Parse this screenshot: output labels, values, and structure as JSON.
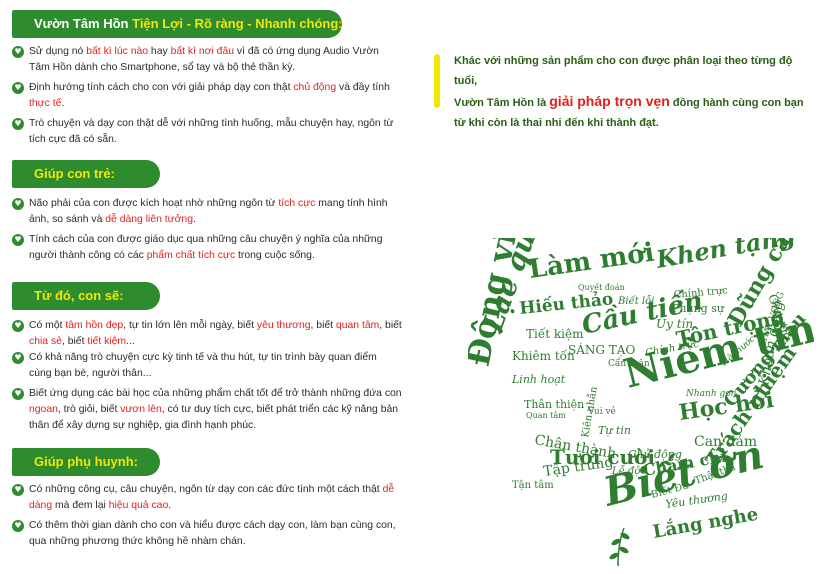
{
  "sections": [
    {
      "banner": {
        "prefix": "Vườn Tâm Hồn ",
        "highlight": "Tiện Lợi - Rõ ràng - Nhanh chóng:"
      },
      "bullets": [
        {
          "parts": [
            {
              "t": "Sử dụng nó "
            },
            {
              "t": "bất kì lúc nào",
              "red": true
            },
            {
              "t": " hay "
            },
            {
              "t": "bất kì nơi đâu",
              "red": true
            },
            {
              "t": " vì đã có ứng dụng Audio Vườn Tâm Hồn dành cho Smartphone, sổ tay và bộ thẻ thần kỳ."
            }
          ]
        },
        {
          "parts": [
            {
              "t": "Định hướng tính cách cho con với giải pháp dạy con thật "
            },
            {
              "t": "chủ động",
              "red": true
            },
            {
              "t": " và đầy tính "
            },
            {
              "t": "thực tế",
              "red": true
            },
            {
              "t": "."
            }
          ]
        },
        {
          "parts": [
            {
              "t": "Trò chuyện và dạy con thật dễ với những tình huống, mẫu chuyện hay, ngôn từ tích cực đã có sẵn."
            }
          ]
        }
      ]
    },
    {
      "banner": {
        "prefix": "",
        "highlight": "Giúp con trẻ:"
      },
      "bullets": [
        {
          "parts": [
            {
              "t": "Não phải của con được kích hoạt nhờ những ngôn từ "
            },
            {
              "t": "tích cực",
              "red": true
            },
            {
              "t": " mang tính hình ảnh, so sánh và "
            },
            {
              "t": "dễ dàng liên tưởng",
              "red": true
            },
            {
              "t": "."
            }
          ]
        },
        {
          "parts": [
            {
              "t": "Tính cách của con được giáo dục qua những câu chuyện ý nghĩa của những người thành công có các "
            },
            {
              "t": "phẩm chất tích cực",
              "red": true
            },
            {
              "t": " trong cuộc sống."
            }
          ]
        }
      ]
    },
    {
      "banner": {
        "prefix": "",
        "highlight": "Từ đó, con sẽ:"
      },
      "bullets": [
        {
          "parts": [
            {
              "t": "Có một "
            },
            {
              "t": "tâm hồn đẹp",
              "red": true
            },
            {
              "t": ", tự tin lớn lên mỗi ngày, biết "
            },
            {
              "t": "yêu thương",
              "red": true
            },
            {
              "t": ", biết "
            },
            {
              "t": "quan tâm",
              "red": true
            },
            {
              "t": ", biết "
            },
            {
              "t": "chia sẻ",
              "red": true
            },
            {
              "t": ", biết "
            },
            {
              "t": "tiết kiệm",
              "red": true
            },
            {
              "t": "..."
            }
          ]
        },
        {
          "parts": [
            {
              "t": "Có khả năng trò chuyện cực kỳ tinh tế và thu hút, tự tin trình bày quan điểm cùng bạn bè, người thân..."
            }
          ]
        },
        {
          "parts": [
            {
              "t": "Biết ứng dụng các bài học của những phẩm chất tốt để trở thành những đứa con "
            },
            {
              "t": "ngoan",
              "red": true
            },
            {
              "t": ", trò giỏi, biết "
            },
            {
              "t": "vươn lên",
              "red": true
            },
            {
              "t": ", có tư duy tích cực, biết phát triển các kỹ năng bản thân để xây dựng sự nghiệp, gia đình hạnh phúc."
            }
          ]
        }
      ]
    },
    {
      "banner": {
        "prefix": "",
        "highlight": "Giúp phụ huynh:"
      },
      "bullets": [
        {
          "parts": [
            {
              "t": "Có những công cụ, câu chuyện, ngôn từ dạy con các đức tính một cách thật "
            },
            {
              "t": "dễ dàng",
              "red": true
            },
            {
              "t": " mà đem lại "
            },
            {
              "t": "hiệu quả cao",
              "red": true
            },
            {
              "t": "."
            }
          ]
        },
        {
          "parts": [
            {
              "t": "Có thêm thời gian dành cho con và hiểu được cách dạy con, làm bạn cùng con, qua những phương thức không hề nhàm chán."
            }
          ]
        }
      ]
    }
  ],
  "intro": {
    "line1": "Khác với những sản phẩm cho con được phân loại theo từng độ tuổi,",
    "line2_prefix": "Vườn Tâm Hồn là ",
    "line2_highlight": "giải pháp trọn vẹn",
    "line2_suffix": " đồng hành cùng con bạn",
    "line3": "từ khi còn là thai nhi đến khi thành đạt."
  },
  "heart_words": [
    "Làm mới",
    "Khen tặng",
    "Quyết đoán",
    "Hiếu thảo",
    "Biết lỗi",
    "Tiết kiệm",
    "Chính trực",
    "Cầu tiến",
    "Giúp đỡ",
    "Khiêm tốn",
    "Uy tín",
    "Phụng sự",
    "Dũng cảm",
    "Chính trực",
    "SÁNG TẠO",
    "Tôn trọng",
    "Linh hoạt",
    "Cẩn thận",
    "Niềm tin",
    "Hài hước",
    "Thân thiện",
    "Quan tâm",
    "Nhanh gọn",
    "Học hỏi",
    "Chân thành",
    "Tự tin",
    "Kiên nhẫn",
    "Tươi cười",
    "Chủ động",
    "Can đảm",
    "Tập trung",
    "Lễ độ",
    "Chăm chỉ",
    "Tận tâm",
    "Biết ơn",
    "Trách nhiệm",
    "Biết Đủ",
    "Yêu thương",
    "Lắng nghe",
    "Động viên",
    "Lạc quan",
    "Gương mẫu",
    "KHÁT VỌNG",
    "Khoan dung",
    "Thật thà",
    "Vui vẻ"
  ],
  "colors": {
    "green": "#2e8b2e",
    "yellow": "#f2e600",
    "red": "#e3211b",
    "dark_green_text": "#2a5e14",
    "heart_green": "#2f7d30"
  }
}
